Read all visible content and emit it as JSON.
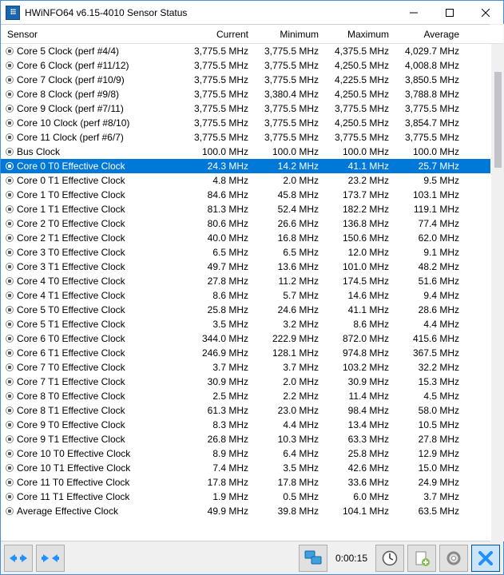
{
  "window": {
    "title": "HWiNFO64 v6.15-4010 Sensor Status"
  },
  "columns": {
    "sensor": "Sensor",
    "current": "Current",
    "minimum": "Minimum",
    "maximum": "Maximum",
    "average": "Average"
  },
  "rows": [
    {
      "name": "Core 5 Clock (perf #4/4)",
      "cur": "3,775.5 MHz",
      "min": "3,775.5 MHz",
      "max": "4,375.5 MHz",
      "avg": "4,029.7 MHz",
      "selected": false
    },
    {
      "name": "Core 6 Clock (perf #11/12)",
      "cur": "3,775.5 MHz",
      "min": "3,775.5 MHz",
      "max": "4,250.5 MHz",
      "avg": "4,008.8 MHz",
      "selected": false
    },
    {
      "name": "Core 7 Clock (perf #10/9)",
      "cur": "3,775.5 MHz",
      "min": "3,775.5 MHz",
      "max": "4,225.5 MHz",
      "avg": "3,850.5 MHz",
      "selected": false
    },
    {
      "name": "Core 8 Clock (perf #9/8)",
      "cur": "3,775.5 MHz",
      "min": "3,380.4 MHz",
      "max": "4,250.5 MHz",
      "avg": "3,788.8 MHz",
      "selected": false
    },
    {
      "name": "Core 9 Clock (perf #7/11)",
      "cur": "3,775.5 MHz",
      "min": "3,775.5 MHz",
      "max": "3,775.5 MHz",
      "avg": "3,775.5 MHz",
      "selected": false
    },
    {
      "name": "Core 10 Clock (perf #8/10)",
      "cur": "3,775.5 MHz",
      "min": "3,775.5 MHz",
      "max": "4,250.5 MHz",
      "avg": "3,854.7 MHz",
      "selected": false
    },
    {
      "name": "Core 11 Clock (perf #6/7)",
      "cur": "3,775.5 MHz",
      "min": "3,775.5 MHz",
      "max": "3,775.5 MHz",
      "avg": "3,775.5 MHz",
      "selected": false
    },
    {
      "name": "Bus Clock",
      "cur": "100.0 MHz",
      "min": "100.0 MHz",
      "max": "100.0 MHz",
      "avg": "100.0 MHz",
      "selected": false
    },
    {
      "name": "Core 0 T0 Effective Clock",
      "cur": "24.3 MHz",
      "min": "14.2 MHz",
      "max": "41.1 MHz",
      "avg": "25.7 MHz",
      "selected": true
    },
    {
      "name": "Core 0 T1 Effective Clock",
      "cur": "4.8 MHz",
      "min": "2.0 MHz",
      "max": "23.2 MHz",
      "avg": "9.5 MHz",
      "selected": false
    },
    {
      "name": "Core 1 T0 Effective Clock",
      "cur": "84.6 MHz",
      "min": "45.8 MHz",
      "max": "173.7 MHz",
      "avg": "103.1 MHz",
      "selected": false
    },
    {
      "name": "Core 1 T1 Effective Clock",
      "cur": "81.3 MHz",
      "min": "52.4 MHz",
      "max": "182.2 MHz",
      "avg": "119.1 MHz",
      "selected": false
    },
    {
      "name": "Core 2 T0 Effective Clock",
      "cur": "80.6 MHz",
      "min": "26.6 MHz",
      "max": "136.8 MHz",
      "avg": "77.4 MHz",
      "selected": false
    },
    {
      "name": "Core 2 T1 Effective Clock",
      "cur": "40.0 MHz",
      "min": "16.8 MHz",
      "max": "150.6 MHz",
      "avg": "62.0 MHz",
      "selected": false
    },
    {
      "name": "Core 3 T0 Effective Clock",
      "cur": "6.5 MHz",
      "min": "6.5 MHz",
      "max": "12.0 MHz",
      "avg": "9.1 MHz",
      "selected": false
    },
    {
      "name": "Core 3 T1 Effective Clock",
      "cur": "49.7 MHz",
      "min": "13.6 MHz",
      "max": "101.0 MHz",
      "avg": "48.2 MHz",
      "selected": false
    },
    {
      "name": "Core 4 T0 Effective Clock",
      "cur": "27.8 MHz",
      "min": "11.2 MHz",
      "max": "174.5 MHz",
      "avg": "51.6 MHz",
      "selected": false
    },
    {
      "name": "Core 4 T1 Effective Clock",
      "cur": "8.6 MHz",
      "min": "5.7 MHz",
      "max": "14.6 MHz",
      "avg": "9.4 MHz",
      "selected": false
    },
    {
      "name": "Core 5 T0 Effective Clock",
      "cur": "25.8 MHz",
      "min": "24.6 MHz",
      "max": "41.1 MHz",
      "avg": "28.6 MHz",
      "selected": false
    },
    {
      "name": "Core 5 T1 Effective Clock",
      "cur": "3.5 MHz",
      "min": "3.2 MHz",
      "max": "8.6 MHz",
      "avg": "4.4 MHz",
      "selected": false
    },
    {
      "name": "Core 6 T0 Effective Clock",
      "cur": "344.0 MHz",
      "min": "222.9 MHz",
      "max": "872.0 MHz",
      "avg": "415.6 MHz",
      "selected": false
    },
    {
      "name": "Core 6 T1 Effective Clock",
      "cur": "246.9 MHz",
      "min": "128.1 MHz",
      "max": "974.8 MHz",
      "avg": "367.5 MHz",
      "selected": false
    },
    {
      "name": "Core 7 T0 Effective Clock",
      "cur": "3.7 MHz",
      "min": "3.7 MHz",
      "max": "103.2 MHz",
      "avg": "32.2 MHz",
      "selected": false
    },
    {
      "name": "Core 7 T1 Effective Clock",
      "cur": "30.9 MHz",
      "min": "2.0 MHz",
      "max": "30.9 MHz",
      "avg": "15.3 MHz",
      "selected": false
    },
    {
      "name": "Core 8 T0 Effective Clock",
      "cur": "2.5 MHz",
      "min": "2.2 MHz",
      "max": "11.4 MHz",
      "avg": "4.5 MHz",
      "selected": false
    },
    {
      "name": "Core 8 T1 Effective Clock",
      "cur": "61.3 MHz",
      "min": "23.0 MHz",
      "max": "98.4 MHz",
      "avg": "58.0 MHz",
      "selected": false
    },
    {
      "name": "Core 9 T0 Effective Clock",
      "cur": "8.3 MHz",
      "min": "4.4 MHz",
      "max": "13.4 MHz",
      "avg": "10.5 MHz",
      "selected": false
    },
    {
      "name": "Core 9 T1 Effective Clock",
      "cur": "26.8 MHz",
      "min": "10.3 MHz",
      "max": "63.3 MHz",
      "avg": "27.8 MHz",
      "selected": false
    },
    {
      "name": "Core 10 T0 Effective Clock",
      "cur": "8.9 MHz",
      "min": "6.4 MHz",
      "max": "25.8 MHz",
      "avg": "12.9 MHz",
      "selected": false
    },
    {
      "name": "Core 10 T1 Effective Clock",
      "cur": "7.4 MHz",
      "min": "3.5 MHz",
      "max": "42.6 MHz",
      "avg": "15.0 MHz",
      "selected": false
    },
    {
      "name": "Core 11 T0 Effective Clock",
      "cur": "17.8 MHz",
      "min": "17.8 MHz",
      "max": "33.6 MHz",
      "avg": "24.9 MHz",
      "selected": false
    },
    {
      "name": "Core 11 T1 Effective Clock",
      "cur": "1.9 MHz",
      "min": "0.5 MHz",
      "max": "6.0 MHz",
      "avg": "3.7 MHz",
      "selected": false
    },
    {
      "name": "Average Effective Clock",
      "cur": "49.9 MHz",
      "min": "39.8 MHz",
      "max": "104.1 MHz",
      "avg": "63.5 MHz",
      "selected": false
    }
  ],
  "toolbar": {
    "time": "0:00:15"
  }
}
